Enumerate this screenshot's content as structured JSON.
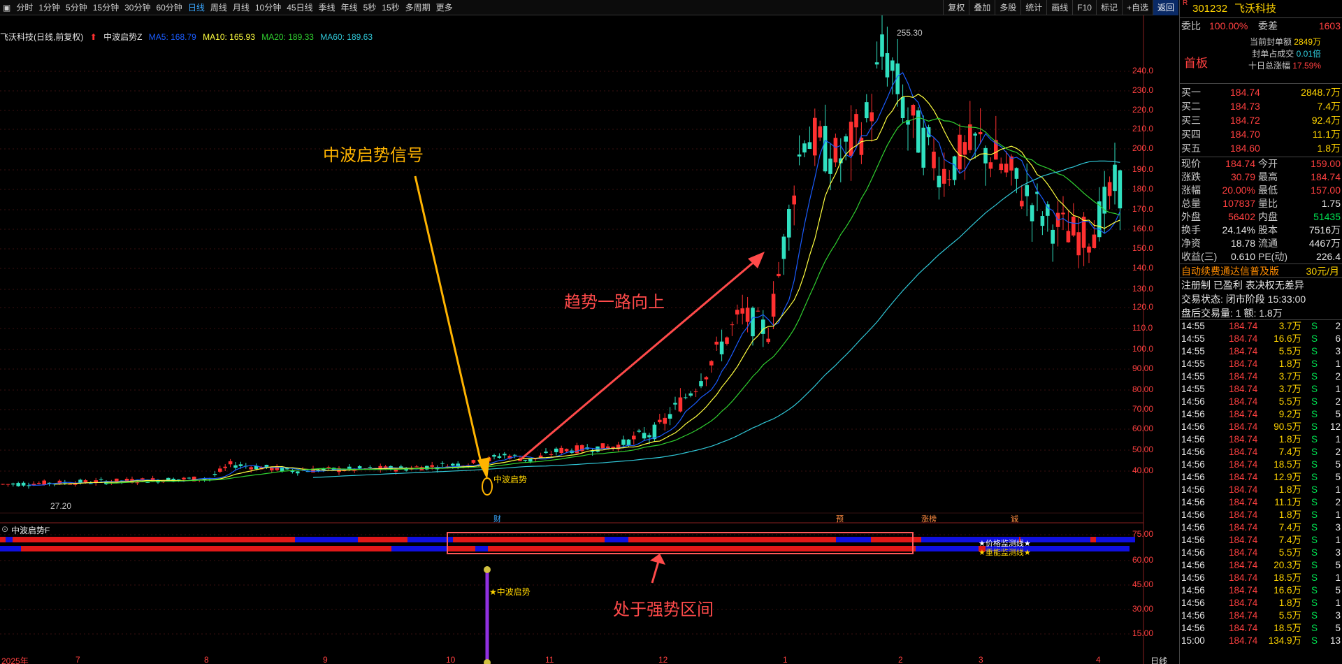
{
  "toolbar": {
    "periods": [
      "分时",
      "1分钟",
      "5分钟",
      "15分钟",
      "30分钟",
      "60分钟",
      "日线",
      "周线",
      "月线",
      "10分钟",
      "45日线",
      "季线",
      "年线",
      "5秒",
      "15秒",
      "多周期",
      "更多"
    ],
    "active": "日线",
    "right": [
      "复权",
      "叠加",
      "多股",
      "统计",
      "画线",
      "F10",
      "标记",
      "+自选",
      "返回"
    ]
  },
  "info": {
    "name": "飞沃科技(日线,前复权)",
    "indicator": "中波启势Z",
    "ma5": "MA5: 168.79",
    "ma10": "MA10: 165.93",
    "ma20": "MA20: 189.33",
    "ma60": "MA60: 189.63"
  },
  "annotations": {
    "signal": "中波启势信号",
    "trend": "趋势一路向上",
    "zone": "处于强势区间",
    "signal_tag": "中波启势",
    "signal_tag2": "★中波启势",
    "high": "255.30",
    "low": "27.20"
  },
  "sub": {
    "name": "中波启势F",
    "line1": "★价格监测线★",
    "line2": "★重能监测线★"
  },
  "events": [
    "财",
    "预",
    "涨榜",
    "诚"
  ],
  "x_axis": [
    "2025年",
    "7",
    "8",
    "9",
    "10",
    "11",
    "12",
    "1",
    "2",
    "3",
    "4"
  ],
  "x_axis_right": "日线",
  "y_axis": [
    "240.0",
    "230.0",
    "220.0",
    "210.0",
    "200.0",
    "190.0",
    "180.0",
    "170.0",
    "160.0",
    "150.0",
    "140.0",
    "130.0",
    "120.0",
    "110.0",
    "100.0",
    "90.00",
    "80.00",
    "70.00",
    "60.00",
    "50.00",
    "40.00"
  ],
  "sub_axis": [
    "75.00",
    "60.00",
    "45.00",
    "30.00",
    "15.00"
  ],
  "stock": {
    "code": "301232",
    "name": "飞沃科技",
    "ratio_label": "委比",
    "ratio": "100.00%",
    "diff_label": "委差",
    "diff": "1603",
    "seal_amt_label": "当前封单额",
    "seal_amt": "2849万",
    "seal_ratio_label": "封单占成交",
    "seal_ratio": "0.01倍",
    "ten_day_label": "十日总涨幅",
    "ten_day": "17.59%",
    "board": "首板"
  },
  "bids": [
    {
      "label": "买一",
      "price": "184.74",
      "vol": "2848.7万"
    },
    {
      "label": "买二",
      "price": "184.73",
      "vol": "7.4万"
    },
    {
      "label": "买三",
      "price": "184.72",
      "vol": "92.4万"
    },
    {
      "label": "买四",
      "price": "184.70",
      "vol": "11.1万"
    },
    {
      "label": "买五",
      "price": "184.60",
      "vol": "1.8万"
    }
  ],
  "quote": [
    {
      "l1": "现价",
      "v1": "184.74",
      "l2": "今开",
      "v2": "159.00"
    },
    {
      "l1": "涨跌",
      "v1": "30.79",
      "l2": "最高",
      "v2": "184.74"
    },
    {
      "l1": "涨幅",
      "v1": "20.00%",
      "l2": "最低",
      "v2": "157.00"
    },
    {
      "l1": "总量",
      "v1": "107837",
      "l2": "量比",
      "v2": "1.75"
    },
    {
      "l1": "外盘",
      "v1": "56402",
      "l2": "内盘",
      "v2": "51435"
    },
    {
      "l1": "换手",
      "v1": "24.14%",
      "l2": "股本",
      "v2": "7516万"
    },
    {
      "l1": "净资",
      "v1": "18.78",
      "l2": "流通",
      "v2": "4467万"
    },
    {
      "l1": "收益(三)",
      "v1": "0.610",
      "l2": "PE(动)",
      "v2": "226.4"
    }
  ],
  "promo": {
    "text": "自动续费通达信普及版",
    "price": "30元/月"
  },
  "reg": "注册制 已盈利 表决权无差异",
  "status": "交易状态: 闭市阶段 15:33:00",
  "after": "盘后交易量: 1  额: 1.8万",
  "trades": [
    [
      "14:55",
      "184.74",
      "3.7万",
      "S",
      "2"
    ],
    [
      "14:55",
      "184.74",
      "16.6万",
      "S",
      "6"
    ],
    [
      "14:55",
      "184.74",
      "5.5万",
      "S",
      "3"
    ],
    [
      "14:55",
      "184.74",
      "1.8万",
      "S",
      "1"
    ],
    [
      "14:55",
      "184.74",
      "3.7万",
      "S",
      "2"
    ],
    [
      "14:55",
      "184.74",
      "3.7万",
      "S",
      "1"
    ],
    [
      "14:56",
      "184.74",
      "5.5万",
      "S",
      "2"
    ],
    [
      "14:56",
      "184.74",
      "9.2万",
      "S",
      "5"
    ],
    [
      "14:56",
      "184.74",
      "90.5万",
      "S",
      "12"
    ],
    [
      "14:56",
      "184.74",
      "1.8万",
      "S",
      "1"
    ],
    [
      "14:56",
      "184.74",
      "7.4万",
      "S",
      "2"
    ],
    [
      "14:56",
      "184.74",
      "18.5万",
      "S",
      "5"
    ],
    [
      "14:56",
      "184.74",
      "12.9万",
      "S",
      "5"
    ],
    [
      "14:56",
      "184.74",
      "1.8万",
      "S",
      "1"
    ],
    [
      "14:56",
      "184.74",
      "11.1万",
      "S",
      "2"
    ],
    [
      "14:56",
      "184.74",
      "1.8万",
      "S",
      "1"
    ],
    [
      "14:56",
      "184.74",
      "7.4万",
      "S",
      "3"
    ],
    [
      "14:56",
      "184.74",
      "7.4万",
      "S",
      "1"
    ],
    [
      "14:56",
      "184.74",
      "5.5万",
      "S",
      "3"
    ],
    [
      "14:56",
      "184.74",
      "20.3万",
      "S",
      "5"
    ],
    [
      "14:56",
      "184.74",
      "18.5万",
      "S",
      "1"
    ],
    [
      "14:56",
      "184.74",
      "16.6万",
      "S",
      "5"
    ],
    [
      "14:56",
      "184.74",
      "1.8万",
      "S",
      "1"
    ],
    [
      "14:56",
      "184.74",
      "5.5万",
      "S",
      "3"
    ],
    [
      "14:56",
      "184.74",
      "18.5万",
      "S",
      "5"
    ],
    [
      "15:00",
      "184.74",
      "134.9万",
      "S",
      "13"
    ]
  ],
  "colors": {
    "up": "#ff3030",
    "down": "#30e0c0",
    "ma5": "#1a5cff",
    "ma10": "#ffff40",
    "ma20": "#30d030",
    "ma60": "#30c8d8",
    "annot": "#ffb400",
    "arrow": "#ff4a4a"
  }
}
